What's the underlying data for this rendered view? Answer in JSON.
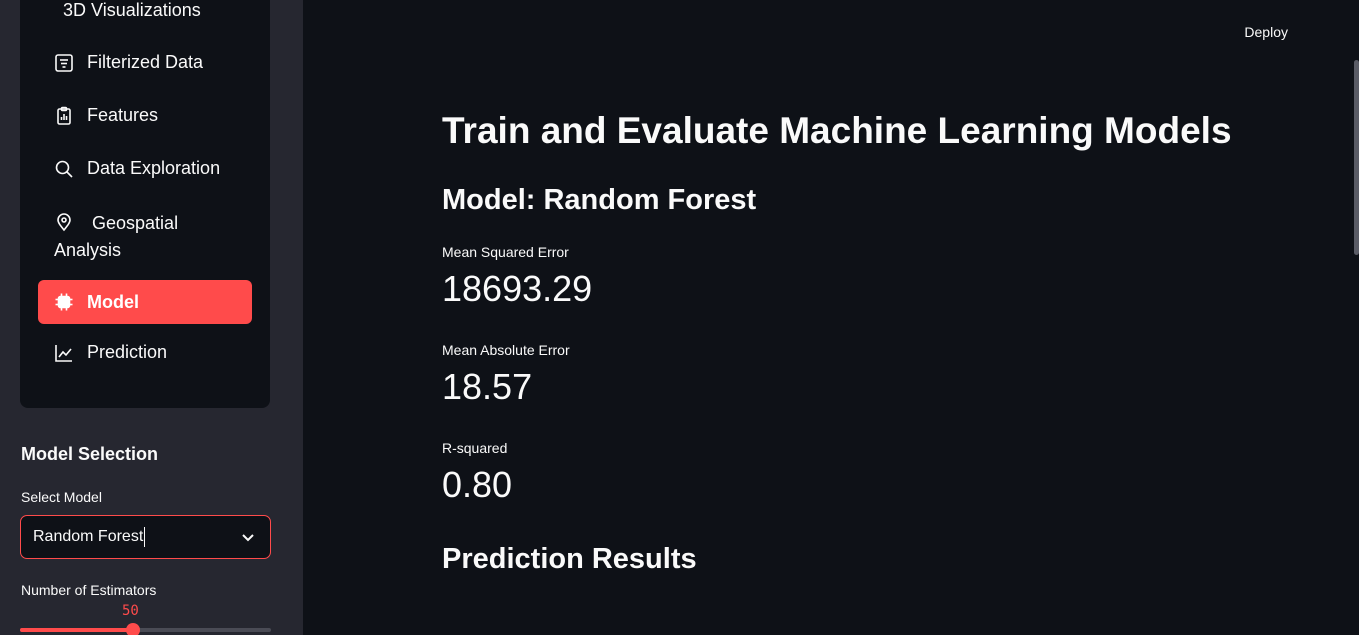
{
  "sidebar": {
    "menu": [
      {
        "label": "3D Visualizations",
        "icon": "cube-icon"
      },
      {
        "label": "Filterized Data",
        "icon": "filter-list-icon"
      },
      {
        "label": "Features",
        "icon": "clipboard-chart-icon"
      },
      {
        "label": "Data Exploration",
        "icon": "search-icon"
      },
      {
        "label": "Geospatial Analysis",
        "icon": "map-pin-icon"
      },
      {
        "label": "Model",
        "icon": "chip-icon"
      },
      {
        "label": "Prediction",
        "icon": "trend-chart-icon"
      }
    ],
    "active_item": "Model",
    "section_title": "Model Selection",
    "select_label": "Select Model",
    "select_value": "Random Forest",
    "estimators_label": "Number of Estimators",
    "estimators_value": "50",
    "estimators_fraction": 0.45,
    "accent_color": "#ff4b4b"
  },
  "header": {
    "deploy_label": "Deploy"
  },
  "main": {
    "title": "Train and Evaluate Machine Learning Models",
    "model_heading": "Model: Random Forest",
    "metrics": [
      {
        "label": "Mean Squared Error",
        "value": "18693.29"
      },
      {
        "label": "Mean Absolute Error",
        "value": "18.57"
      },
      {
        "label": "R-squared",
        "value": "0.80"
      }
    ],
    "results_heading": "Prediction Results"
  }
}
